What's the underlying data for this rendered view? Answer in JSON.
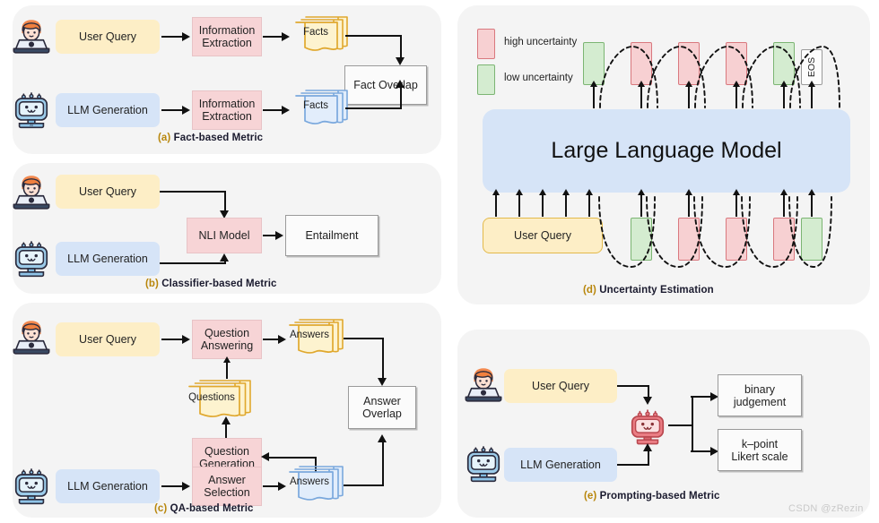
{
  "figure": {
    "watermark": "CSDN @zRezin"
  },
  "panels": {
    "a": {
      "caption_label": "(a)",
      "caption_text": " Fact-based Metric",
      "nodes": {
        "user_query": "User Query",
        "llm_generation": "LLM Generation",
        "info_extraction_top": "Information\nExtraction",
        "info_extraction_bottom": "Information\nExtraction",
        "facts_top": "Facts",
        "facts_bottom": "Facts",
        "fact_overlap": "Fact Overlap"
      },
      "icons": {
        "user": "user-laptop-icon",
        "bot": "robot-icon"
      }
    },
    "b": {
      "caption_label": "(b)",
      "caption_text": " Classifier-based Metric",
      "nodes": {
        "user_query": "User Query",
        "llm_generation": "LLM Generation",
        "nli_model": "NLI Model",
        "entailment": "Entailment"
      },
      "icons": {
        "user": "user-laptop-icon",
        "bot": "robot-icon"
      }
    },
    "c": {
      "caption_label": "(c)",
      "caption_text": " QA-based Metric",
      "nodes": {
        "user_query": "User Query",
        "llm_generation": "LLM Generation",
        "question_answering": "Question\nAnswering",
        "question_generation": "Question\nGeneration",
        "answer_selection": "Answer\nSelection",
        "answers_top": "Answers",
        "answers_bottom": "Answers",
        "questions": "Questions",
        "answer_overlap": "Answer\nOverlap"
      },
      "icons": {
        "user": "user-laptop-icon",
        "bot": "robot-icon"
      }
    },
    "d": {
      "caption_label": "(d)",
      "caption_text": " Uncertainty Estimation",
      "legend": [
        {
          "key": "high",
          "label": "high uncertainty",
          "color": "#f7d0d2",
          "border": "#d9787e"
        },
        {
          "key": "low",
          "label": "low uncertainty",
          "color": "#d4ecd0",
          "border": "#7cb573"
        }
      ],
      "model_label": "Large Language Model",
      "user_query": "User Query",
      "eos_label": "EOS",
      "output_tokens": [
        "low",
        "high",
        "high",
        "high",
        "low",
        "eos"
      ],
      "input_tokens": [
        "low",
        "high",
        "high",
        "high",
        "low"
      ]
    },
    "e": {
      "caption_label": "(e)",
      "caption_text": " Prompting-based Metric",
      "nodes": {
        "user_query": "User Query",
        "llm_generation": "LLM Generation",
        "binary_judgement": "binary\njudgement",
        "likert_scale": "k–point\nLikert scale"
      },
      "icons": {
        "user": "user-laptop-icon",
        "bot": "robot-icon",
        "judge": "judge-robot-icon"
      }
    }
  }
}
